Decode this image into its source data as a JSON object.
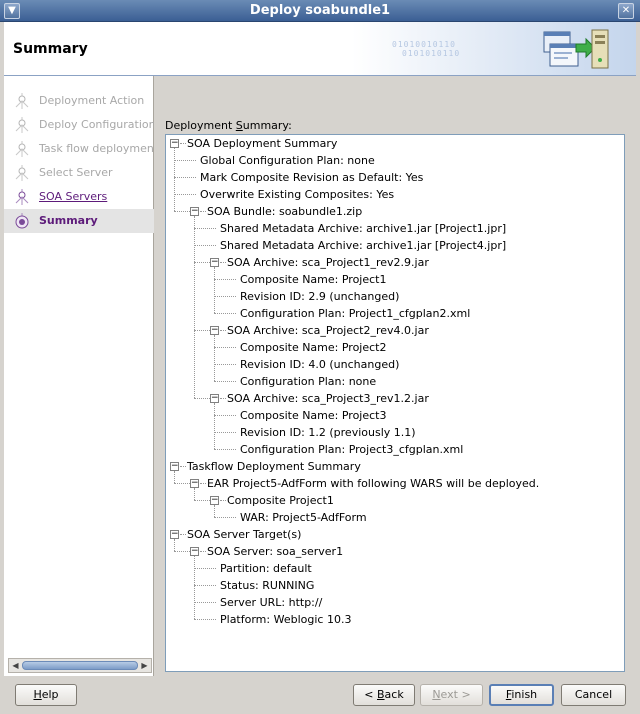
{
  "window": {
    "title": "Deploy soabundle1"
  },
  "header": {
    "title": "Summary",
    "decor_bits": "01010010110",
    "decor_bits2": "0101010110"
  },
  "nav": {
    "items": [
      {
        "label": "Deployment Action",
        "state": "done"
      },
      {
        "label": "Deploy Configuration",
        "state": "done"
      },
      {
        "label": "Task flow deployment",
        "state": "done"
      },
      {
        "label": "Select Server",
        "state": "done"
      },
      {
        "label": "SOA Servers",
        "state": "link"
      },
      {
        "label": "Summary",
        "state": "active"
      }
    ]
  },
  "summary": {
    "label": "Deployment Summary:",
    "tree": [
      {
        "text": "SOA Deployment Summary",
        "level": 0,
        "expanded": true
      },
      {
        "text": "Global Configuration Plan: none",
        "level": 1
      },
      {
        "text": "Mark Composite Revision as Default: Yes",
        "level": 1
      },
      {
        "text": "Overwrite Existing Composites: Yes",
        "level": 1
      },
      {
        "text": "SOA Bundle: soabundle1.zip",
        "level": 1,
        "expanded": true
      },
      {
        "text": "Shared Metadata Archive: archive1.jar [Project1.jpr]",
        "level": 2
      },
      {
        "text": "Shared Metadata Archive: archive1.jar [Project4.jpr]",
        "level": 2
      },
      {
        "text": "SOA Archive: sca_Project1_rev2.9.jar",
        "level": 2,
        "expanded": true
      },
      {
        "text": "Composite Name: Project1",
        "level": 3
      },
      {
        "text": "Revision ID: 2.9 (unchanged)",
        "level": 3
      },
      {
        "text": "Configuration Plan: Project1_cfgplan2.xml",
        "level": 3
      },
      {
        "text": "SOA Archive: sca_Project2_rev4.0.jar",
        "level": 2,
        "expanded": true
      },
      {
        "text": "Composite Name: Project2",
        "level": 3
      },
      {
        "text": "Revision ID: 4.0 (unchanged)",
        "level": 3
      },
      {
        "text": "Configuration Plan: none",
        "level": 3
      },
      {
        "text": "SOA Archive: sca_Project3_rev1.2.jar",
        "level": 2,
        "expanded": true
      },
      {
        "text": "Composite Name: Project3",
        "level": 3
      },
      {
        "text": "Revision ID: 1.2 (previously 1.1)",
        "level": 3
      },
      {
        "text": "Configuration Plan: Project3_cfgplan.xml",
        "level": 3
      },
      {
        "text": "Taskflow Deployment Summary",
        "level": 0,
        "expanded": true
      },
      {
        "text": "EAR Project5-AdfForm with following WARS will be deployed.",
        "level": 1,
        "expanded": true
      },
      {
        "text": "Composite Project1",
        "level": 2,
        "expanded": true
      },
      {
        "text": "WAR: Project5-AdfForm",
        "level": 3
      },
      {
        "text": "SOA Server Target(s)",
        "level": 0,
        "expanded": true
      },
      {
        "text": "SOA Server: soa_server1",
        "level": 1,
        "expanded": true
      },
      {
        "text": "Partition: default",
        "level": 2
      },
      {
        "text": "Status: RUNNING",
        "level": 2
      },
      {
        "text": "Server URL: http://",
        "level": 2
      },
      {
        "text": "Platform: Weblogic 10.3",
        "level": 2
      }
    ]
  },
  "buttons": {
    "help": "Help",
    "back": "< Back",
    "next": "Next >",
    "finish": "Finish",
    "cancel": "Cancel"
  },
  "colors": {
    "accent": "#5d1b7a",
    "titlebar": "#3b5f94",
    "tree_border": "#7f9db9"
  }
}
